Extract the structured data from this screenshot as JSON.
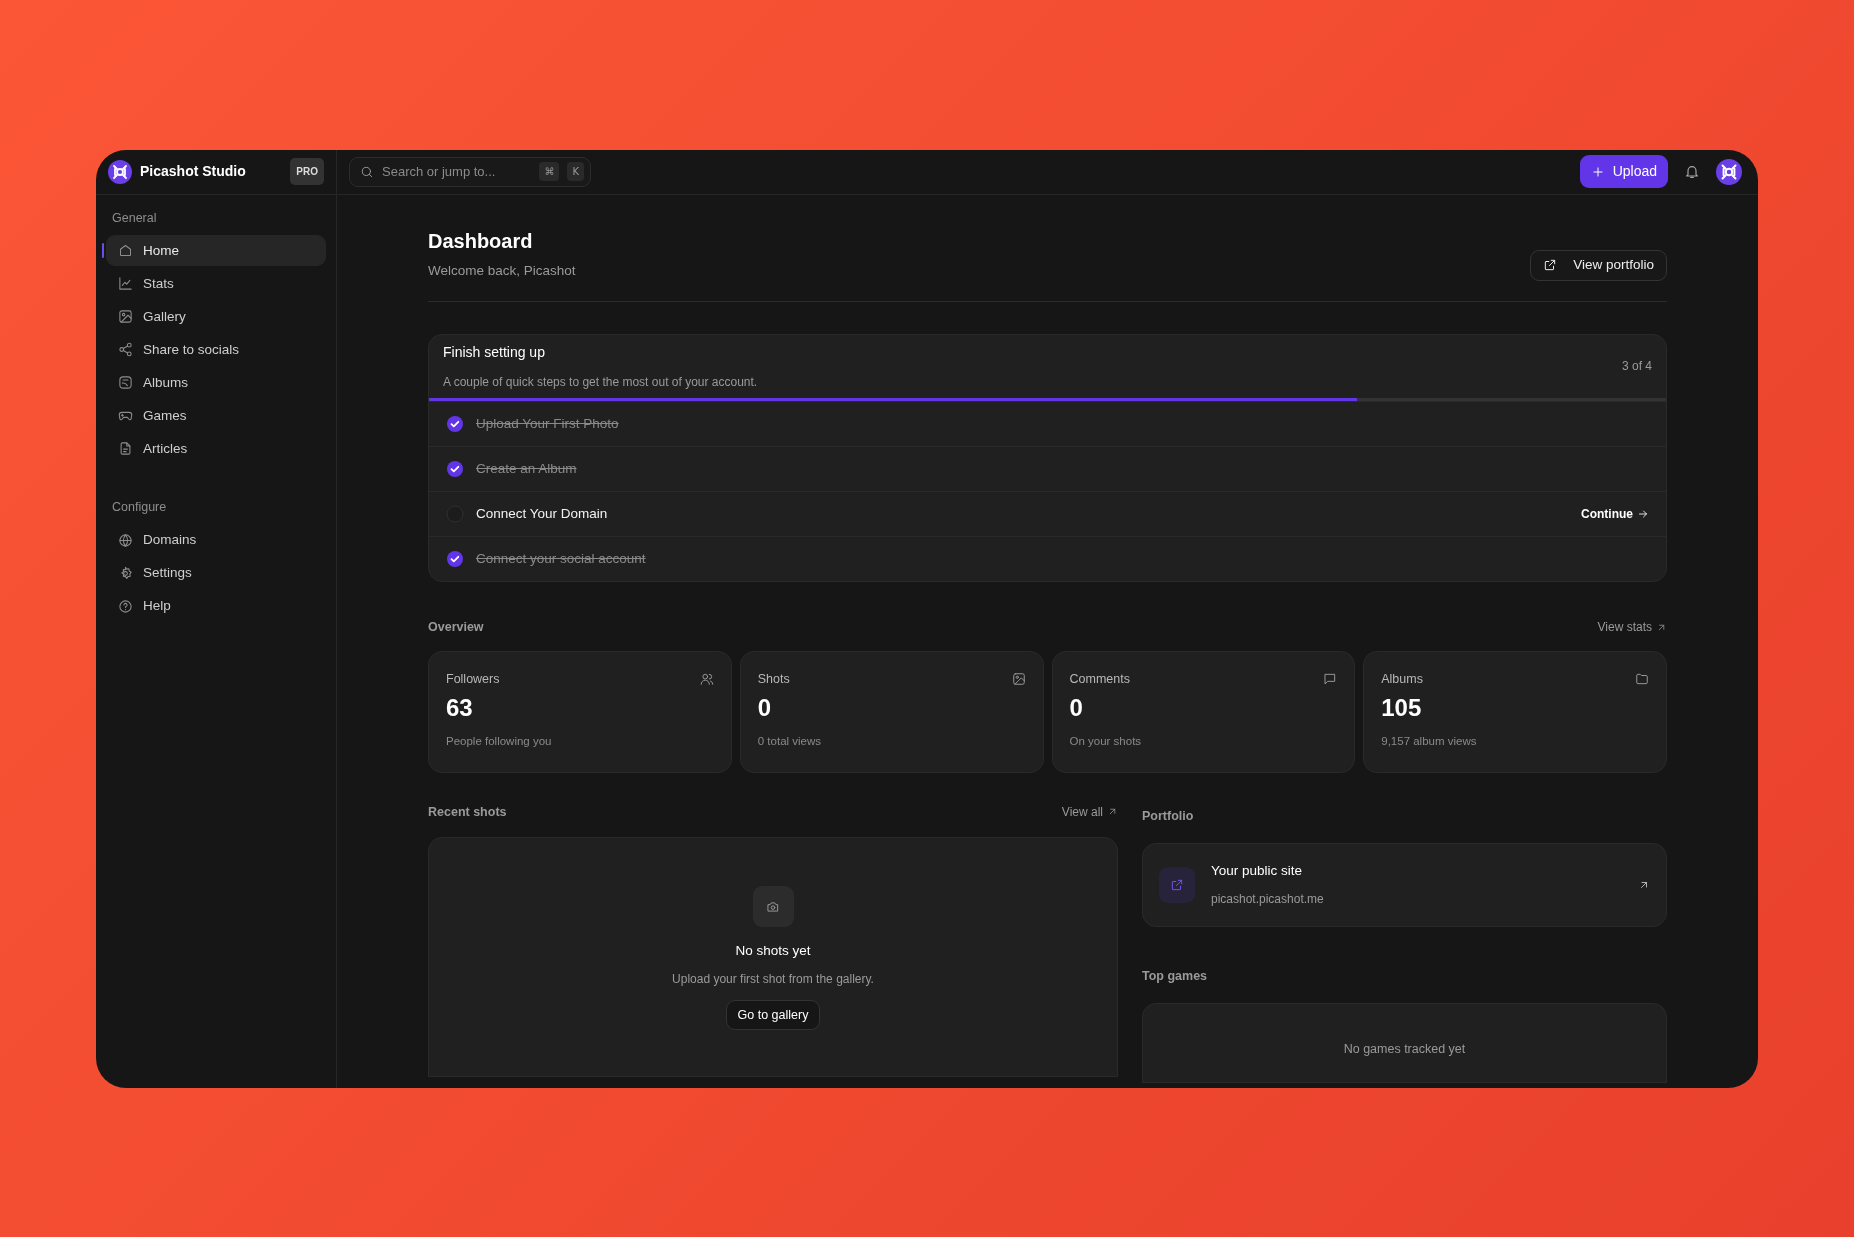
{
  "app": {
    "name": "Picashot Studio",
    "plan_badge": "PRO"
  },
  "search": {
    "placeholder": "Search or jump to...",
    "keys": [
      "⌘",
      "K"
    ]
  },
  "upload_button": "Upload",
  "sidebar": {
    "sections": [
      {
        "title": "General",
        "items": [
          {
            "label": "Home",
            "selected": true
          },
          {
            "label": "Stats",
            "selected": false
          },
          {
            "label": "Gallery",
            "selected": false
          },
          {
            "label": "Share to socials",
            "selected": false
          },
          {
            "label": "Albums",
            "selected": false
          },
          {
            "label": "Games",
            "selected": false
          },
          {
            "label": "Articles",
            "selected": false
          }
        ]
      },
      {
        "title": "Configure",
        "items": [
          {
            "label": "Domains",
            "selected": false
          },
          {
            "label": "Settings",
            "selected": false
          },
          {
            "label": "Help",
            "selected": false
          }
        ]
      }
    ]
  },
  "page": {
    "title": "Dashboard",
    "subtitle": "Welcome back, Picashot",
    "view_portfolio": "View portfolio"
  },
  "setup": {
    "title": "Finish setting up",
    "description": "A couple of quick steps to get the most out of your account.",
    "progress_text": "3 of 4",
    "level": 0.75,
    "steps": [
      {
        "label": "Upload Your First Photo",
        "checked": true
      },
      {
        "label": "Create an Album",
        "checked": true
      },
      {
        "label": "Connect Your Domain",
        "checked": false,
        "action": "Continue"
      },
      {
        "label": "Connect your social account",
        "checked": true
      }
    ]
  },
  "overview": {
    "title": "Overview",
    "link": "View stats",
    "stats": [
      {
        "label": "Followers",
        "value": "63",
        "caption": "People following you"
      },
      {
        "label": "Shots",
        "value": "0",
        "caption": "0 total views"
      },
      {
        "label": "Comments",
        "value": "0",
        "caption": "On your shots"
      },
      {
        "label": "Albums",
        "value": "105",
        "caption": "9,157 album views"
      }
    ]
  },
  "recent_shots": {
    "title": "Recent shots",
    "link": "View all",
    "empty_title": "No shots yet",
    "empty_text": "Upload your first shot from the gallery.",
    "button": "Go to gallery"
  },
  "portfolio": {
    "title": "Portfolio",
    "site_title": "Your public site",
    "site_url": "picashot.picashot.me"
  },
  "top_games": {
    "title": "Top games",
    "empty_text": "No games tracked yet"
  }
}
